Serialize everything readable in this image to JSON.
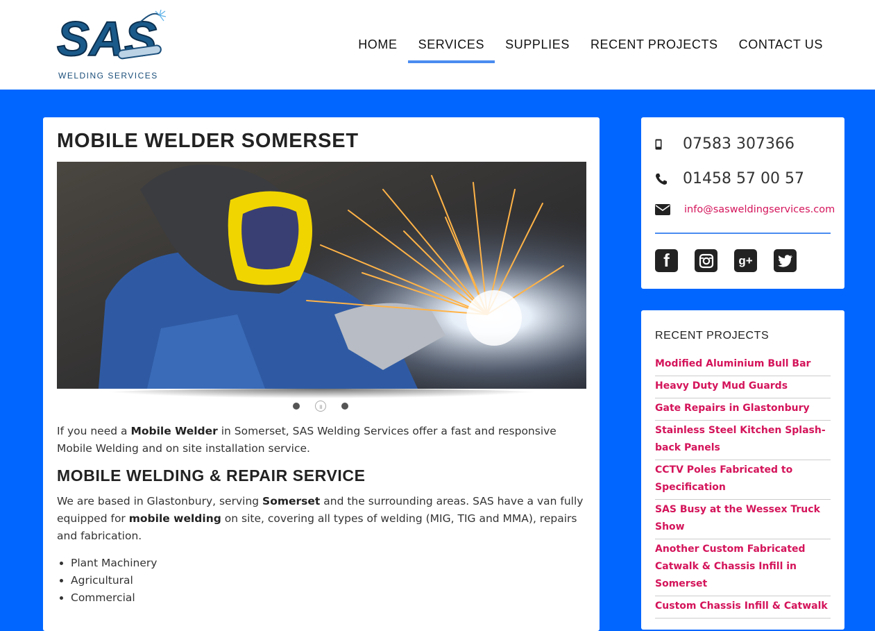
{
  "header": {
    "logo_text": "SAS",
    "logo_subtitle": "WELDING SERVICES",
    "nav": [
      {
        "label": "HOME",
        "active": false
      },
      {
        "label": "SERVICES",
        "active": true
      },
      {
        "label": "SUPPLIES",
        "active": false
      },
      {
        "label": "RECENT PROJECTS",
        "active": false
      },
      {
        "label": "CONTACT US",
        "active": false
      }
    ]
  },
  "main": {
    "title": "MOBILE WELDER SOMERSET",
    "slider": {
      "slide_count": 3,
      "active_slide": 2
    },
    "intro": {
      "t1": "If you need a ",
      "b1": "Mobile Welder",
      "t2": " in Somerset, SAS Welding Services offer a fast and responsive Mobile Welding and on site installation service."
    },
    "subtitle": "MOBILE WELDING & REPAIR SERVICE",
    "para2": {
      "t1": "We are based in Glastonbury, serving ",
      "b1": "Somerset",
      "t2": " and the surrounding areas. SAS have a van fully equipped for ",
      "b2": "mobile welding",
      "t3": " on site, covering all types of welding (MIG, TIG and MMA), repairs and fabrication."
    },
    "list": [
      "Plant Machinery",
      "Agricultural",
      "Commercial"
    ]
  },
  "contact": {
    "mobile": "07583 307366",
    "phone": "01458 57 00 57",
    "email": "info@sasweldingservices.com",
    "socials": [
      "facebook",
      "instagram",
      "google-plus",
      "twitter"
    ]
  },
  "recent": {
    "title": "RECENT PROJECTS",
    "items": [
      "Modified Aluminium Bull Bar",
      "Heavy Duty Mud Guards",
      "Gate Repairs in Glastonbury",
      "Stainless Steel Kitchen Splash-back Panels",
      "CCTV Poles Fabricated to Specification",
      "SAS Busy at the Wessex Truck Show",
      "Another Custom Fabricated Catwalk & Chassis Infill in Somerset",
      "Custom Chassis Infill & Catwalk"
    ]
  },
  "colors": {
    "accent_blue": "#0066ff",
    "nav_underline": "#4a8cf0",
    "link": "#d4145a"
  }
}
